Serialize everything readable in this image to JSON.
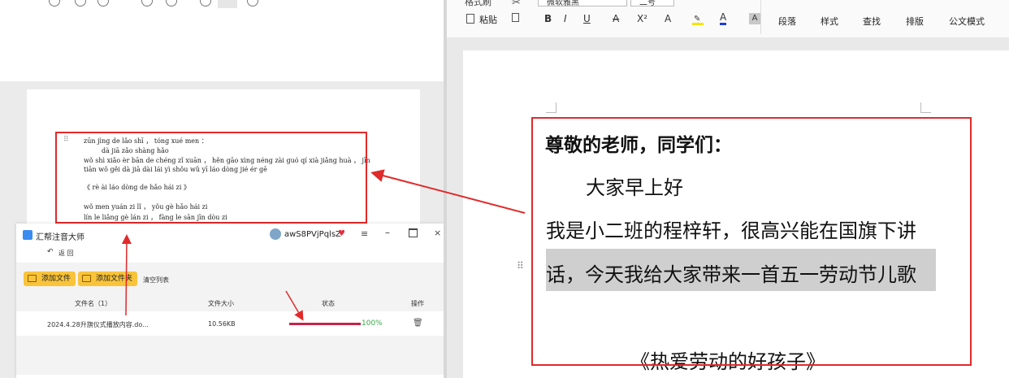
{
  "left_editor": {
    "pinyin_lines": [
      "zūn jìng de lǎo shī ，  tóng xué men ：",
      "dà jiā zǎo shàng hǎo",
      "wǒ shì xiǎo èr bān de chéng zǐ xuān ，  hěn gāo xìng néng zài guó qí xià jiǎng huà ，  jīn",
      "tiān wǒ gěi dà jiā dài lái yì shǒu wǔ yī láo dòng jié ér gē",
      "《 rè ài láo dòng de hǎo hái zi 》",
      "wǒ men yuán zi lǐ ，     yǒu gè hǎo hái zi",
      "lín le liǎng gè lán zi ，  fàng le sān jīn dòu zi"
    ]
  },
  "app": {
    "title": "汇帮注音大师",
    "username": "awS8PVjPqlsZ",
    "back_label": "返 回",
    "buttons": {
      "add_file": "添加文件",
      "add_folder": "添加文件夹",
      "clear_list": "清空列表"
    },
    "columns": [
      "文件名（1）",
      "文件大小",
      "状态",
      "操作"
    ],
    "rows": [
      {
        "name": "2024.4.28升旗仪式播放内容.do...",
        "size": "10.56KB",
        "progress": 1.0,
        "progress_label": "100%"
      }
    ]
  },
  "ribbon": {
    "clipboard_label": "粘贴",
    "format_painter_label": "格式刷",
    "font_name": "微软雅黑",
    "font_size": "二号",
    "format_buttons": [
      "B",
      "I",
      "U",
      "A",
      "X²",
      "A",
      "A"
    ],
    "groups": [
      "段落",
      "样式",
      "查找",
      "排版",
      "公文模式"
    ]
  },
  "doc": {
    "heading": "尊敬的老师，同学们：",
    "lines": [
      "大家早上好",
      "我是小二班的程梓轩，很高兴能在国旗下讲",
      "话，今天我给大家带来一首五一劳动节儿歌",
      "《热爱劳动的好孩子》"
    ]
  },
  "colors": {
    "annotation_red": "#e12a2a",
    "progress_color": "#c8234a",
    "progress_text": "#3aa94a",
    "button_yellow": "#f9c43a",
    "selection_gray": "#cfcfcf"
  }
}
